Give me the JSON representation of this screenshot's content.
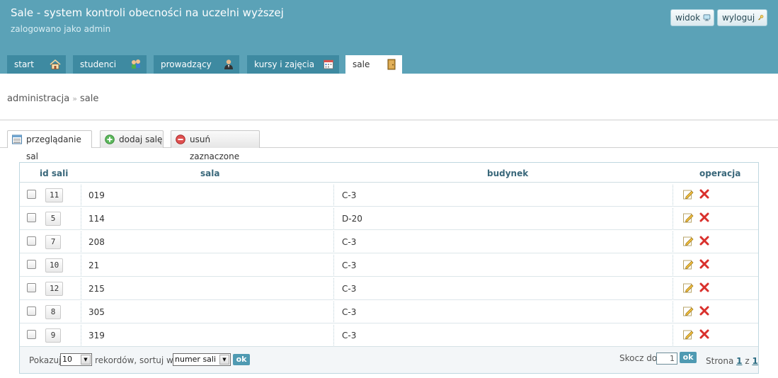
{
  "header": {
    "title": "Sale - system kontroli obecności na uczelni wyższej",
    "login_info": "zalogowano jako admin",
    "view_label": "widok",
    "logout_label": "wyloguj"
  },
  "nav": {
    "tabs": [
      {
        "label": "start",
        "icon": "home-icon"
      },
      {
        "label": "studenci",
        "icon": "students-icon"
      },
      {
        "label": "prowadzący",
        "icon": "teacher-icon"
      },
      {
        "label": "kursy i zajęcia",
        "icon": "calendar-icon"
      },
      {
        "label": "sale",
        "icon": "door-icon",
        "active": true
      }
    ]
  },
  "breadcrumb": {
    "parent": "administracja",
    "separator": "»",
    "current": "sale"
  },
  "subtabs": {
    "browse": "przeglądanie sal",
    "add": "dodaj salę",
    "delete": "usuń zaznaczone"
  },
  "table": {
    "headers": {
      "id": "id sali",
      "sala": "sala",
      "budynek": "budynek",
      "operacja": "operacja"
    },
    "rows": [
      {
        "id": "11",
        "sala": "019",
        "budynek": "C-3"
      },
      {
        "id": "5",
        "sala": "114",
        "budynek": "D-20"
      },
      {
        "id": "7",
        "sala": "208",
        "budynek": "C-3"
      },
      {
        "id": "10",
        "sala": "21",
        "budynek": "C-3"
      },
      {
        "id": "12",
        "sala": "215",
        "budynek": "C-3"
      },
      {
        "id": "8",
        "sala": "305",
        "budynek": "C-3"
      },
      {
        "id": "9",
        "sala": "319",
        "budynek": "C-3"
      }
    ]
  },
  "footer": {
    "show_label": "Pokazuj",
    "per_page": "10",
    "records_label": "rekordów, sortuj wg.",
    "sort_by": "numer sali ↑",
    "ok": "ok",
    "jump_label": "Skocz do",
    "jump_value": "1",
    "page_label": "Strona",
    "page_current": "1",
    "page_of": "z",
    "page_total": "1"
  },
  "colors": {
    "header_bg": "#5ba2b7",
    "tab_bg": "#3e8aa1",
    "accent": "#4f9ab2"
  }
}
